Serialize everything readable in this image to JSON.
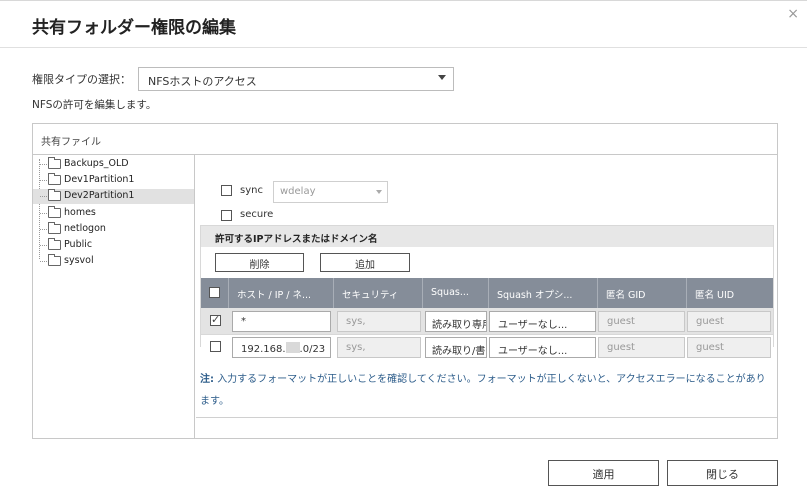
{
  "dialog": {
    "title": "共有フォルダー権限の編集",
    "close_glyph": "×"
  },
  "permission": {
    "label": "権限タイプの選択：",
    "selected": "NFSホストのアクセス",
    "description": "NFSの許可を編集します。"
  },
  "share": {
    "title": "共有ファイル",
    "folders": [
      {
        "label": "Backups_OLD",
        "selected": false
      },
      {
        "label": "Dev1Partition1",
        "selected": false
      },
      {
        "label": "Dev2Partition1",
        "selected": true
      },
      {
        "label": "homes",
        "selected": false
      },
      {
        "label": "netlogon",
        "selected": false
      },
      {
        "label": "Public",
        "selected": false
      },
      {
        "label": "sysvol",
        "selected": false
      }
    ]
  },
  "options": {
    "sync_label": "sync",
    "sync_checked": false,
    "wdelay_value": "wdelay",
    "secure_label": "secure",
    "secure_checked": false
  },
  "ip_panel": {
    "header": "許可するIPアドレスまたはドメイン名",
    "delete_label": "削除",
    "add_label": "追加",
    "columns": [
      "ホスト / IP / ネ...",
      "セキュリティ",
      "Squas...",
      "Squash オプシ...",
      "匿名 GID",
      "匿名 UID"
    ],
    "rows": [
      {
        "checked": true,
        "host": "*",
        "security": "sys,",
        "squash": "読み取り専用",
        "squash_option": "ユーザーなし...",
        "gid": "guest",
        "uid": "guest"
      },
      {
        "checked": false,
        "host_prefix": "192.168.",
        "host_suffix": ".0/23",
        "security": "sys,",
        "squash": "読み取り/書",
        "squash_option": "ユーザーなし...",
        "gid": "guest",
        "uid": "guest"
      }
    ]
  },
  "note": {
    "prefix": "注:",
    "text": "入力するフォーマットが正しいことを確認してください。フォーマットが正しくないと、アクセスエラーになることがあります。"
  },
  "footer": {
    "apply_label": "適用",
    "close_label": "閉じる"
  }
}
